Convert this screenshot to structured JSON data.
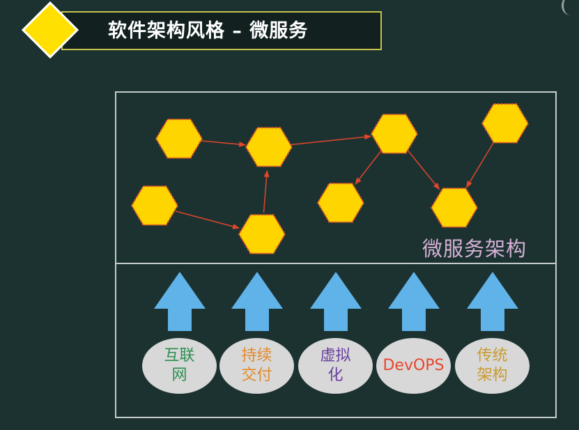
{
  "title": "软件架构风格 – 微服务",
  "architecture_label": "微服务架构",
  "colors": {
    "background": "#1c3231",
    "hexagon_fill": "#ffd500",
    "hexagon_border": "#e8542a",
    "edge_color": "#d6452c",
    "up_arrow": "#5fb3e8",
    "ellipse_fill": "#d8d8d8",
    "label_color": "#d7b1d8"
  },
  "foundations": [
    {
      "label": "互联网",
      "color": "#2a8f4f"
    },
    {
      "label": "持续交付",
      "color": "#e58a2a"
    },
    {
      "label": "虚拟化",
      "color": "#6a3fa0"
    },
    {
      "label": "DevOPS",
      "color": "#e8452c"
    },
    {
      "label": "传统架构",
      "color": "#c99a2e"
    }
  ],
  "icons": {
    "title_marker": "diamond-icon",
    "service_node": "hexagon-icon",
    "support_arrow": "up-arrow-icon"
  }
}
